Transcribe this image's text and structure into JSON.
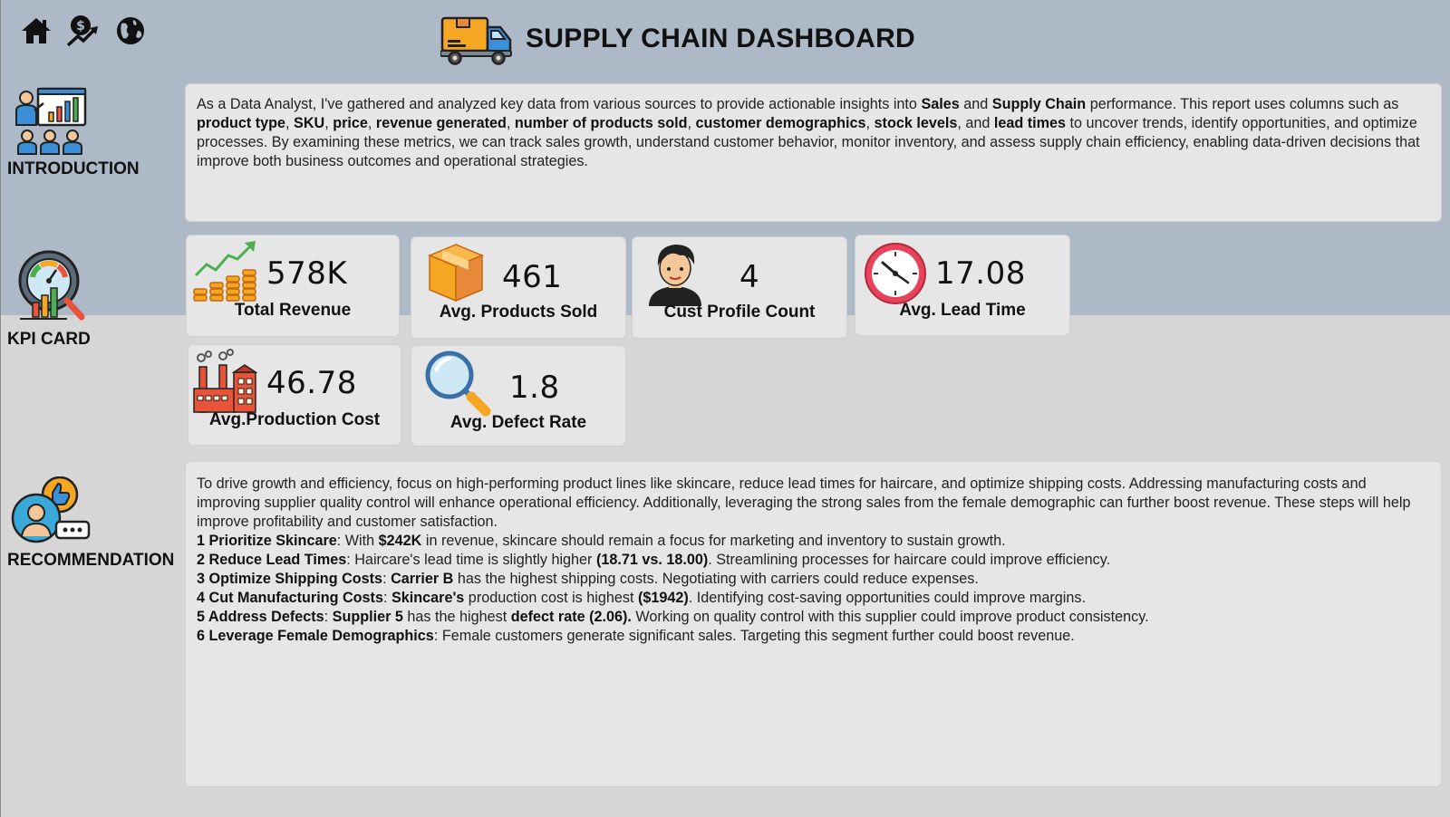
{
  "header": {
    "title": "SUPPLY CHAIN DASHBOARD",
    "nav_icons": [
      "home-icon",
      "revenue-growth-icon",
      "globe-icon"
    ]
  },
  "sections": {
    "introduction": "INTRODUCTION",
    "kpi": "KPI CARD",
    "recommendation": "RECOMMENDATION"
  },
  "intro": {
    "segments": [
      [
        "As a Data Analyst, I've gathered and analyzed key data from various sources to provide actionable insights into ",
        false
      ],
      [
        "Sales",
        true
      ],
      [
        " and ",
        false
      ],
      [
        "Supply Chain",
        true
      ],
      [
        " performance. This report uses columns such as ",
        false
      ],
      [
        "product type",
        true
      ],
      [
        ", ",
        false
      ],
      [
        "SKU",
        true
      ],
      [
        ", ",
        false
      ],
      [
        "price",
        true
      ],
      [
        ", ",
        false
      ],
      [
        "revenue generated",
        true
      ],
      [
        ", ",
        false
      ],
      [
        "number of products sold",
        true
      ],
      [
        ", ",
        false
      ],
      [
        "customer demographics",
        true
      ],
      [
        ", ",
        false
      ],
      [
        "stock levels",
        true
      ],
      [
        ", and ",
        false
      ],
      [
        "lead times",
        true
      ],
      [
        " to uncover trends, identify opportunities, and optimize processes. By examining these metrics, we can track sales growth, understand customer behavior, monitor inventory, and assess supply chain efficiency, enabling data-driven decisions that improve both business outcomes and operational strategies.",
        false
      ]
    ]
  },
  "kpis": {
    "revenue": {
      "value": "578K",
      "label": "Total Revenue",
      "icon": "revenue-chart-icon"
    },
    "products": {
      "value": "461",
      "label": "Avg. Products Sold",
      "icon": "box-icon"
    },
    "customers": {
      "value": "4",
      "label": "Cust Profile Count",
      "icon": "customer-avatar-icon"
    },
    "lead_time": {
      "value": "17.08",
      "label": "Avg. Lead Time",
      "icon": "clock-icon"
    },
    "production": {
      "value": "46.78",
      "label": "Avg.Production Cost",
      "icon": "factory-icon"
    },
    "defect": {
      "value": "1.8",
      "label": "Avg. Defect Rate",
      "icon": "magnifier-icon"
    }
  },
  "recommendation": {
    "intro": "To drive growth and efficiency, focus on high-performing product lines like skincare, reduce lead times for haircare, and optimize shipping costs. Addressing manufacturing costs and improving supplier quality control will enhance operational efficiency. Additionally, leveraging the strong sales from the female demographic can further boost revenue. These steps will help improve profitability and customer satisfaction.",
    "items": [
      [
        [
          "1 Prioritize Skincare",
          true
        ],
        [
          ": With ",
          false
        ],
        [
          "$242K",
          true
        ],
        [
          " in revenue, skincare should remain a focus for marketing and inventory to sustain growth.",
          false
        ]
      ],
      [
        [
          "2 Reduce Lead Times",
          true
        ],
        [
          ": Haircare's lead time is slightly higher ",
          false
        ],
        [
          "(18.71 vs. 18.00)",
          true
        ],
        [
          ". Streamlining processes for haircare could improve efficiency.",
          false
        ]
      ],
      [
        [
          "3 Optimize Shipping Costs",
          true
        ],
        [
          ": ",
          false
        ],
        [
          "Carrier B",
          true
        ],
        [
          " has the highest shipping costs. Negotiating with carriers could reduce expenses.",
          false
        ]
      ],
      [
        [
          "4 Cut Manufacturing Costs",
          true
        ],
        [
          ": ",
          false
        ],
        [
          "Skincare's",
          true
        ],
        [
          " production cost is highest ",
          false
        ],
        [
          "($1942)",
          true
        ],
        [
          ". Identifying cost-saving opportunities could improve margins.",
          false
        ]
      ],
      [
        [
          "5 Address Defects",
          true
        ],
        [
          ": ",
          false
        ],
        [
          "Supplier 5",
          true
        ],
        [
          " has the highest ",
          false
        ],
        [
          "defect rate (2.06).",
          true
        ],
        [
          " Working on quality control with this supplier could improve product consistency.",
          false
        ]
      ],
      [
        [
          "6 Leverage Female Demographics",
          true
        ],
        [
          ": Female customers generate significant sales. Targeting this segment further could boost revenue.",
          false
        ]
      ]
    ]
  }
}
